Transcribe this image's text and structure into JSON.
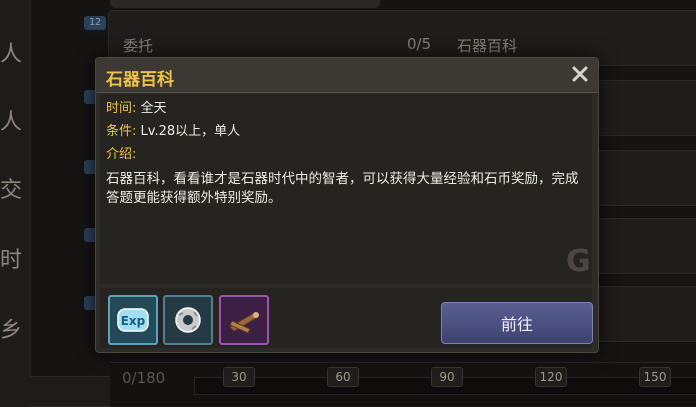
{
  "background": {
    "left_menu": [
      "人",
      "人",
      "交",
      "时",
      "乡"
    ],
    "row_badge": "12",
    "rows": [
      {
        "label": "委托",
        "count": "0/5"
      },
      {
        "label": "石器百科"
      }
    ],
    "progress": {
      "count": "0/180",
      "ticks": [
        "30",
        "60",
        "90",
        "120",
        "150"
      ],
      "fill_fraction": 0.0
    }
  },
  "dialog": {
    "title": "石器百科",
    "time_label": "时间:",
    "time_value": "全天",
    "condition_label": "条件:",
    "condition_value": "Lv.28以上，单人",
    "intro_label": "介绍:",
    "description": "石器百科，看看谁才是石器时代中的智者，可以获得大量经验和石币奖励，完成答题更能获得额外特别奖励。",
    "rewards": [
      {
        "icon": "exp-icon",
        "text": "Exp"
      },
      {
        "icon": "stone-coin-icon"
      },
      {
        "icon": "wood-icon"
      }
    ],
    "go_button": "前往"
  }
}
